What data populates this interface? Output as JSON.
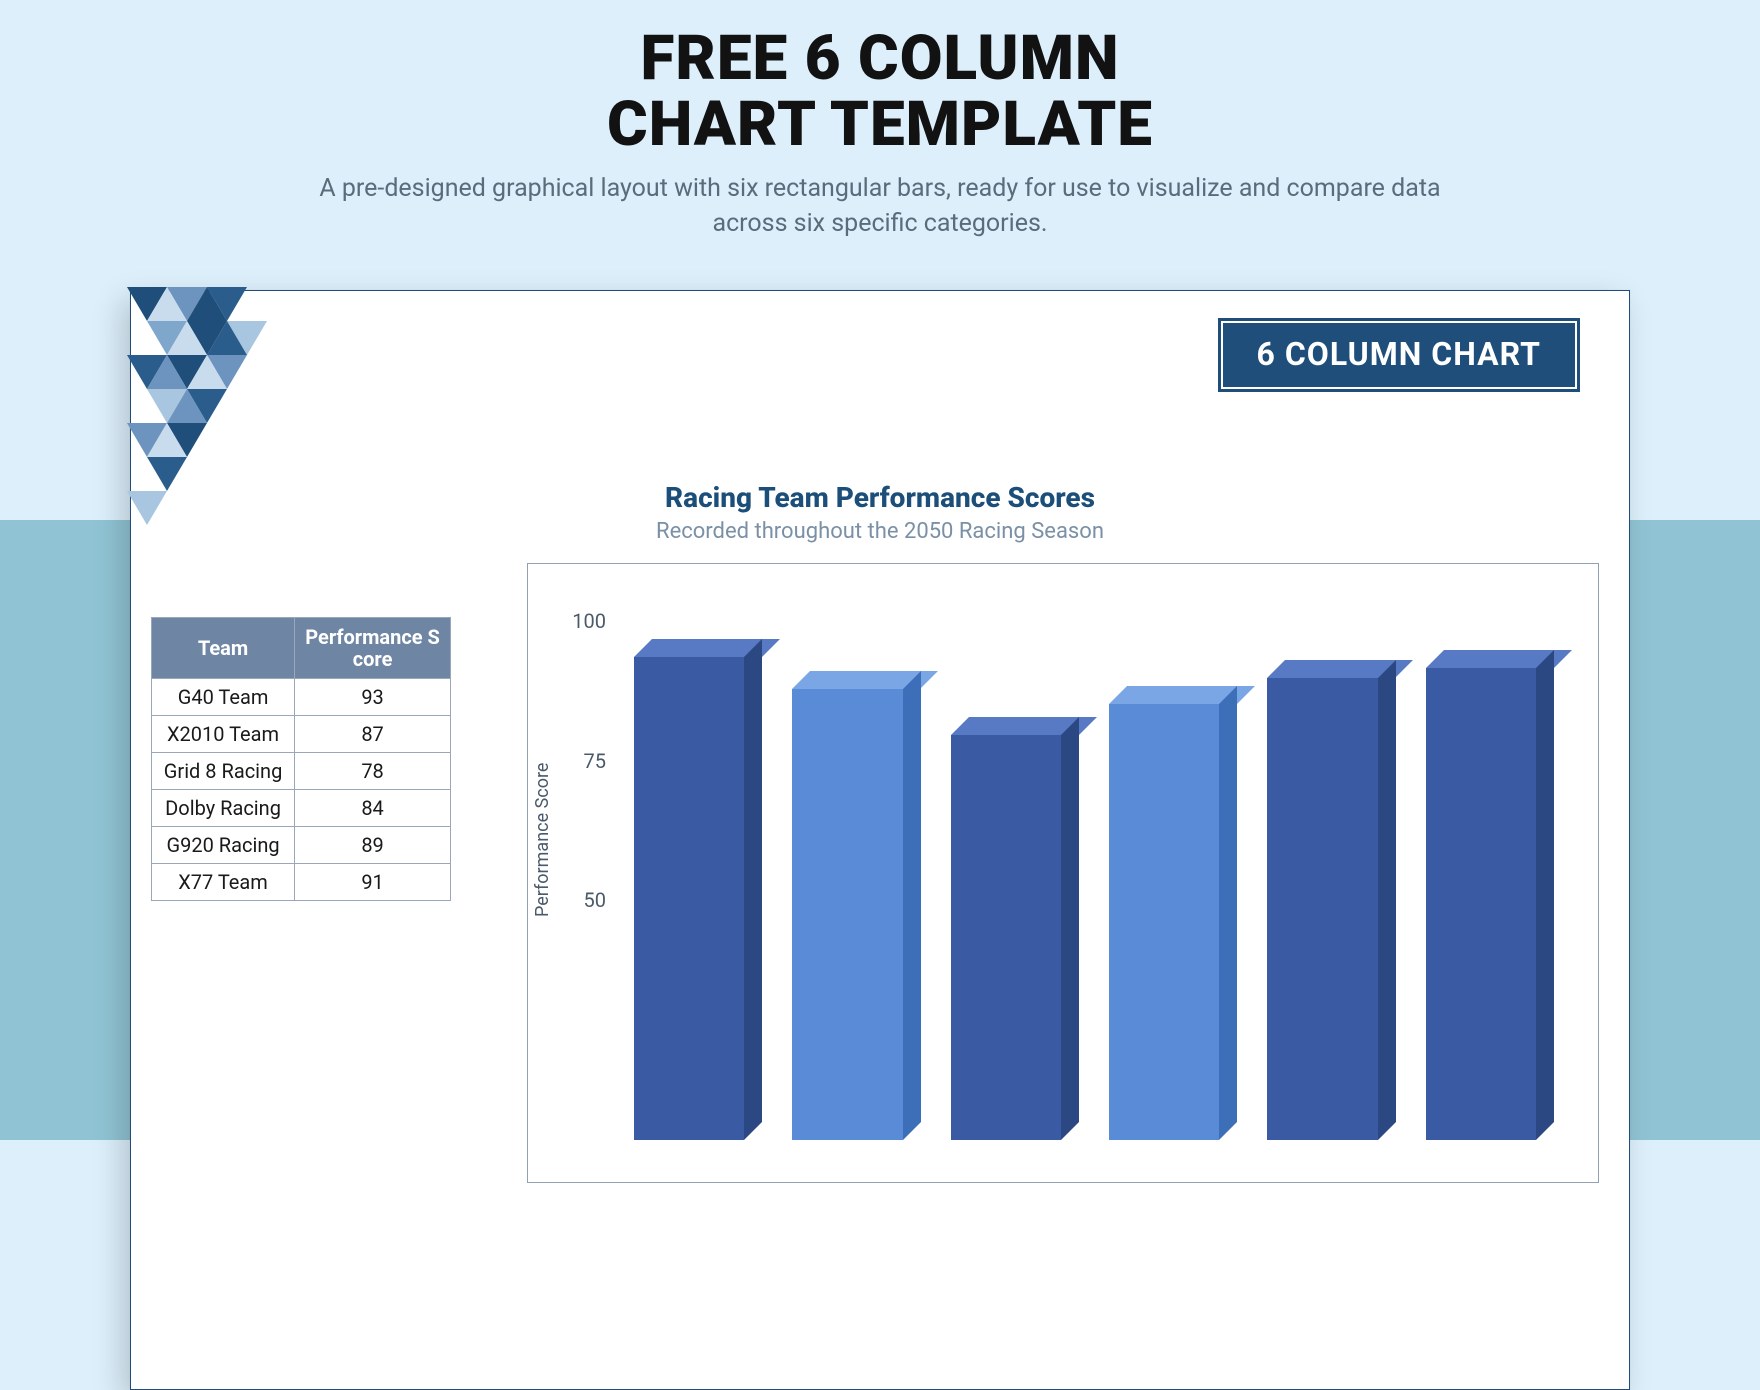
{
  "page": {
    "title_line1": "FREE 6 COLUMN",
    "title_line2": "CHART TEMPLATE",
    "subtitle": "A pre-designed graphical layout with six rectangular bars, ready for use to visualize and compare data across six specific categories."
  },
  "card": {
    "badge": "6 COLUMN CHART",
    "chart_title": "Racing Team Performance Scores",
    "chart_subtitle": "Recorded throughout the 2050 Racing Season"
  },
  "table": {
    "headers": {
      "team": "Team",
      "score_line1": "Performance S",
      "score_line2": "core"
    },
    "rows": [
      {
        "team": "G40 Team",
        "score": "93"
      },
      {
        "team": "X2010 Team",
        "score": "87"
      },
      {
        "team": "Grid 8 Racing",
        "score": "78"
      },
      {
        "team": "Dolby Racing",
        "score": "84"
      },
      {
        "team": "G920 Racing",
        "score": "89"
      },
      {
        "team": "X77 Team",
        "score": "91"
      }
    ]
  },
  "chart_data": {
    "type": "bar",
    "title": "Racing Team Performance Scores",
    "subtitle": "Recorded throughout the 2050 Racing Season",
    "xlabel": "",
    "ylabel": "Performance Score",
    "ylim": [
      0,
      100
    ],
    "yticks": [
      50,
      75,
      100
    ],
    "categories": [
      "G40 Team",
      "X2010 Team",
      "Grid 8 Racing",
      "Dolby Racing",
      "G920 Racing",
      "X77 Team"
    ],
    "values": [
      93,
      87,
      78,
      84,
      89,
      91
    ],
    "legend": null,
    "grid": false,
    "style": "3d",
    "y_tick_labels": {
      "t100": "100",
      "t75": "75",
      "t50": "50"
    }
  }
}
